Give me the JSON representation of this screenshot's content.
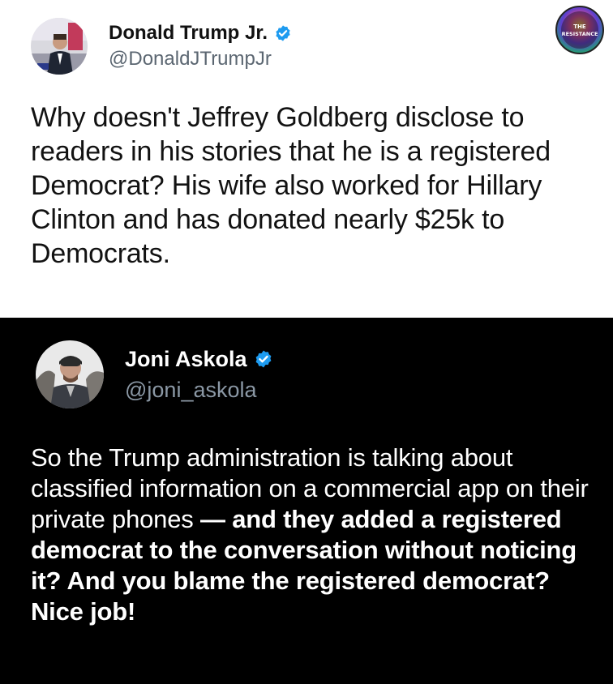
{
  "tweet1": {
    "display_name": "Donald Trump Jr.",
    "handle": "@DonaldJTrumpJr",
    "text": "Why doesn't Jeffrey Goldberg disclose to readers in his stories that he is a registered Democrat? His wife also worked for Hillary Clinton and has donated nearly $25k to Democrats.",
    "verified": true
  },
  "tweet2": {
    "display_name": "Joni Askola",
    "handle": "@joni_askola",
    "text_regular": "So the Trump administration is talking about classified information on a commercial app on their private phones",
    "text_bold": "— and they added a registered democrat to the conversation without noticing it? And you blame the registered democrat? Nice job!",
    "verified": true
  },
  "watermark": {
    "line1": "THE",
    "line2": "RESISTANCE"
  },
  "colors": {
    "verified_blue": "#1d9bf0",
    "top_bg": "#ffffff",
    "bottom_bg": "#000000"
  },
  "icons": [
    "avatar",
    "verified-badge-icon",
    "resistance-logo"
  ]
}
